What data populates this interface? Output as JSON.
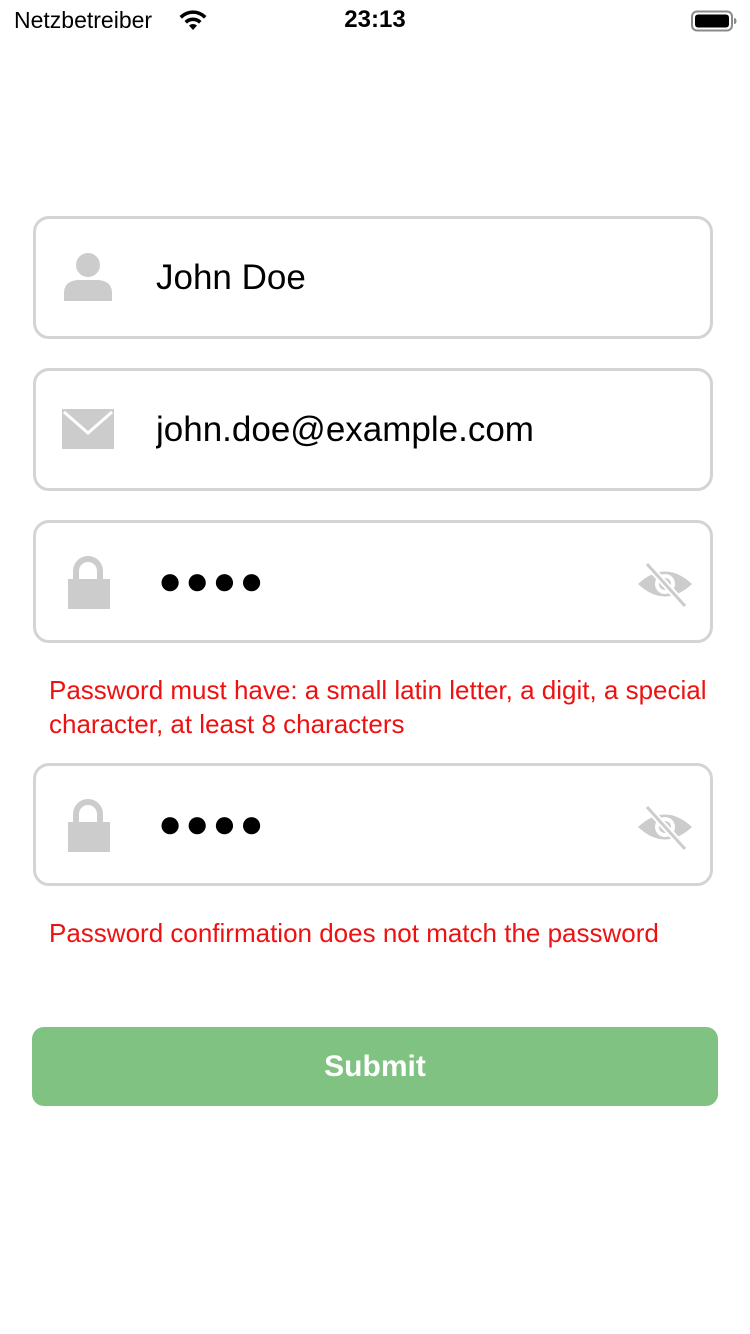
{
  "status_bar": {
    "carrier": "Netzbetreiber",
    "time": "23:13"
  },
  "form": {
    "name_field": {
      "icon": "person-icon",
      "value": "John Doe"
    },
    "email_field": {
      "icon": "envelope-icon",
      "value": "john.doe@example.com"
    },
    "password_field": {
      "icon": "lock-icon",
      "masked_value": "●●●●",
      "toggle_icon": "eye-slash-icon",
      "error": "Password must have: a small latin letter, a digit, a special character, at least 8 characters"
    },
    "confirm_password_field": {
      "icon": "lock-icon",
      "masked_value": "●●●●",
      "toggle_icon": "eye-slash-icon",
      "error": "Password confirmation does not match the password"
    },
    "submit_label": "Submit"
  },
  "colors": {
    "error": "#ee1111",
    "submit_background": "#80c281",
    "field_border": "#d4d4d4",
    "icon_gray": "#cccccc"
  }
}
